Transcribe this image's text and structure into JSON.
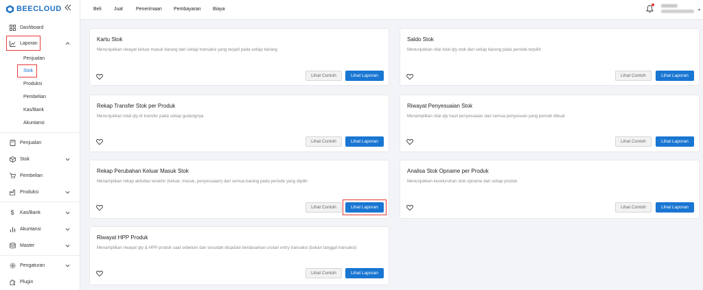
{
  "brand": {
    "name": "BEECLOUD",
    "color": "#1d6fc4"
  },
  "sidebar": {
    "items": [
      {
        "id": "dashboard",
        "label": "Dashboard",
        "icon": "dashboard-icon"
      },
      {
        "id": "laporan",
        "label": "Laporan",
        "icon": "chart-icon",
        "expanded": true
      },
      {
        "id": "penjualan",
        "label": "Penjualan",
        "icon": "receipt-icon"
      },
      {
        "id": "stok",
        "label": "Stok",
        "icon": "box-icon"
      },
      {
        "id": "pembelian",
        "label": "Pembelian",
        "icon": "cart-icon"
      },
      {
        "id": "produksi",
        "label": "Produksi",
        "icon": "factory-icon"
      },
      {
        "id": "kasbank",
        "label": "Kas/Bank",
        "icon": "dollar-icon"
      },
      {
        "id": "akuntansi",
        "label": "Akuntansi",
        "icon": "bar-chart-icon"
      },
      {
        "id": "master",
        "label": "Master",
        "icon": "database-icon"
      },
      {
        "id": "pengaturan",
        "label": "Pengaturan",
        "icon": "gear-icon"
      },
      {
        "id": "plugin",
        "label": "Plugin",
        "icon": "plugin-icon"
      }
    ],
    "laporan_sub": [
      "Penjualan",
      "Stok",
      "Produksi",
      "Pembelian",
      "Kas/Bank",
      "Akuntansi"
    ],
    "active_sub": "Stok"
  },
  "topbar": {
    "nav": [
      "Beli",
      "Jual",
      "Penerimaan",
      "Pembayaran",
      "Biaya"
    ]
  },
  "cards": [
    {
      "title": "Kartu Stok",
      "desc": "Menunjukkan riwayat keluar masuk barang dari setiap transaksi yang terjadi pada setiap barang"
    },
    {
      "title": "Saldo Stok",
      "desc": "Menunjukkan nilai total qty stok dari setiap barang pada periode terpilih"
    },
    {
      "title": "Rekap Transfer Stok per Produk",
      "desc": "Menunjukkan total qty di transfer pada setiap gudangnya"
    },
    {
      "title": "Riwayat Penyesuaian Stok",
      "desc": "Menampilkan nilai qty hasil penyesuaian dari semua penyesuan yang pernah dibuat"
    },
    {
      "title": "Rekap Perubahan Keluar Masuk Stok",
      "desc": "Menampilkan rekap aktivitas terakhir (keluar, masuk, penyesuaian) dari semua barang pada periode yang dipilih"
    },
    {
      "title": "Analisa Stok Opname per Produk",
      "desc": "Menunjukkan keseluruhan stok opname dari setiap produk"
    },
    {
      "title": "Riwayat HPP Produk",
      "desc": "Menampilkan riwayat qty & HPP produk saat sebelum dan sesudah diupdate berdasarkan urutan entry transaksi (bukan tanggal transaksi)"
    }
  ],
  "buttons": {
    "contoh": "Lihat Contoh",
    "lihat": "Lihat Laporan"
  },
  "colors": {
    "accent": "#1976d2",
    "highlight": "#e53935"
  }
}
